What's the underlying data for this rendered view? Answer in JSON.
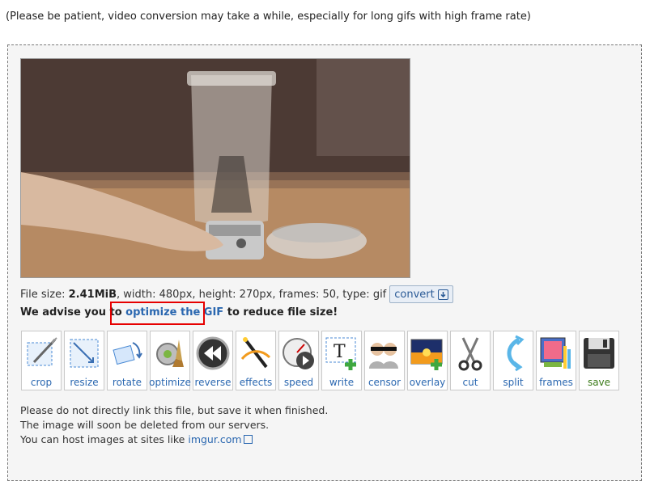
{
  "notice": "(Please be patient, video conversion may take a while, especially for long gifs with high frame rate)",
  "file_info": {
    "size_label": "File size:",
    "size_value": "2.41MiB",
    "rest": ", width: 480px, height: 270px, frames: 50, type: gif",
    "convert_label": "convert"
  },
  "advise": {
    "prefix": "We advise you to",
    "link": "optimize the GIF",
    "suffix": "to reduce file size!"
  },
  "tools": [
    {
      "label": "crop",
      "icon": "crop-icon"
    },
    {
      "label": "resize",
      "icon": "resize-icon"
    },
    {
      "label": "rotate",
      "icon": "rotate-icon"
    },
    {
      "label": "optimize",
      "icon": "optimize-icon"
    },
    {
      "label": "reverse",
      "icon": "reverse-icon"
    },
    {
      "label": "effects",
      "icon": "effects-icon"
    },
    {
      "label": "speed",
      "icon": "speed-icon"
    },
    {
      "label": "write",
      "icon": "write-icon"
    },
    {
      "label": "censor",
      "icon": "censor-icon"
    },
    {
      "label": "overlay",
      "icon": "overlay-icon"
    },
    {
      "label": "cut",
      "icon": "scissors-icon"
    },
    {
      "label": "split",
      "icon": "split-icon"
    },
    {
      "label": "frames",
      "icon": "frames-icon"
    },
    {
      "label": "save",
      "icon": "save-icon"
    }
  ],
  "footnote": {
    "line1": "Please do not directly link this file, but save it when finished.",
    "line2": "The image will soon be deleted from our servers.",
    "line3_prefix": "You can host images at sites like",
    "line3_link": "imgur.com"
  },
  "colors": {
    "link": "#2a67b0",
    "highlight": "#e60000",
    "save_label": "#3a7a18"
  }
}
